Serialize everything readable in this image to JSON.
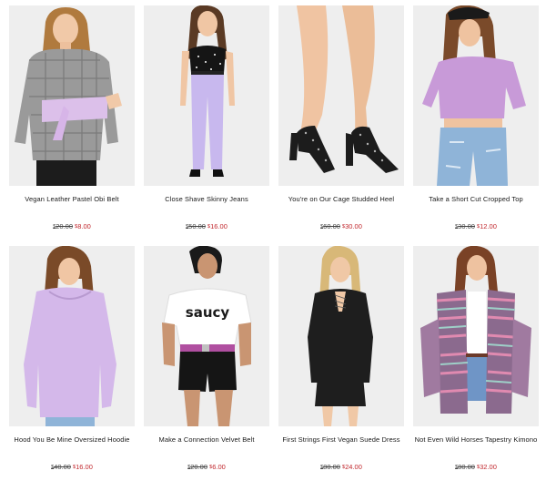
{
  "products": [
    {
      "name": "Vegan Leather Pastel Obi Belt",
      "old_price": "20.00",
      "new_price": "8.00",
      "currency_symbol": "$",
      "image_icon": "model-wearing-obi-belt-image",
      "accent": "#d7b5e8"
    },
    {
      "name": "Close Shave Skinny Jeans",
      "old_price": "50.00",
      "new_price": "16.00",
      "currency_symbol": "$",
      "image_icon": "model-wearing-lilac-jeans-image",
      "accent": "#c8b8ee"
    },
    {
      "name": "You're on Our Cage Studded Heel",
      "old_price": "60.00",
      "new_price": "30.00",
      "currency_symbol": "$",
      "image_icon": "black-caged-heels-image",
      "accent": "#1c1c1c"
    },
    {
      "name": "Take a Short Cut Cropped Top",
      "old_price": "30.00",
      "new_price": "12.00",
      "currency_symbol": "$",
      "image_icon": "model-wearing-lilac-crop-top-image",
      "accent": "#c89ad8"
    },
    {
      "name": "Hood You Be Mine Oversized Hoodie",
      "old_price": "40.00",
      "new_price": "16.00",
      "currency_symbol": "$",
      "image_icon": "model-wearing-lilac-hoodie-image",
      "accent": "#d4b8ea"
    },
    {
      "name": "Make a Connection Velvet Belt",
      "old_price": "20.00",
      "new_price": "6.00",
      "currency_symbol": "$",
      "image_icon": "model-wearing-saucy-tee-image",
      "accent": "#b04fa0"
    },
    {
      "name": "First Strings First Vegan Suede Dress",
      "old_price": "80.00",
      "new_price": "24.00",
      "currency_symbol": "$",
      "image_icon": "model-wearing-black-suede-dress-image",
      "accent": "#1e1e1e"
    },
    {
      "name": "Not Even Wild Horses Tapestry Kimono",
      "old_price": "80.00",
      "new_price": "32.00",
      "currency_symbol": "$",
      "image_icon": "model-wearing-tapestry-kimono-image",
      "accent": "#8b6a8e"
    }
  ],
  "shot_text": {
    "tee_print": "saucy"
  },
  "colors": {
    "sale_price": "#c1272d",
    "original_price": "#444444",
    "photo_background": "#eeeeee"
  }
}
